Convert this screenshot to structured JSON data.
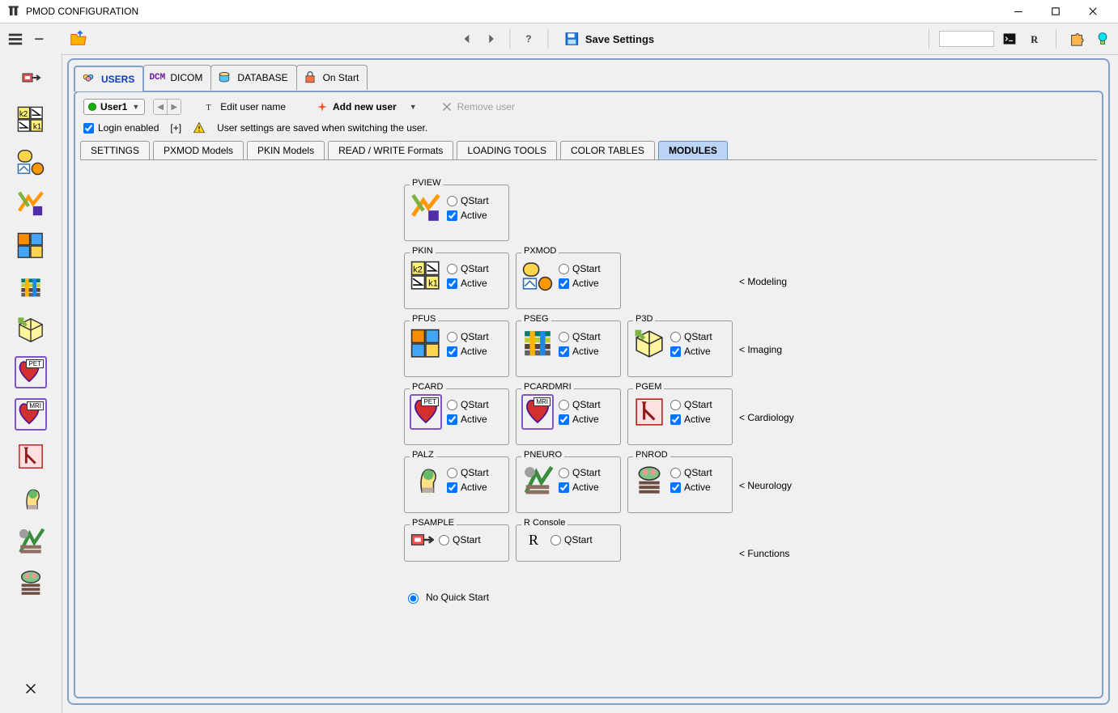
{
  "window": {
    "title": "PMOD CONFIGURATION"
  },
  "toolbar": {
    "save_label": "Save Settings",
    "help_tooltip": "?"
  },
  "primary_tabs": [
    {
      "id": "users",
      "label": "USERS",
      "active": true
    },
    {
      "id": "dicom",
      "label": "DICOM",
      "active": false
    },
    {
      "id": "database",
      "label": "DATABASE",
      "active": false
    },
    {
      "id": "onstart",
      "label": "On Start",
      "active": false
    }
  ],
  "user_bar": {
    "current_user": "User1",
    "edit_label": "Edit user name",
    "add_label": "Add new user",
    "remove_label": "Remove user"
  },
  "login_row": {
    "login_enabled_label": "Login enabled",
    "login_enabled_checked": true,
    "plus_label": "[+]",
    "info_text": "User settings are saved when switching the user."
  },
  "secondary_tabs": [
    {
      "id": "settings",
      "label": "SETTINGS",
      "active": false
    },
    {
      "id": "pxmod",
      "label": "PXMOD Models",
      "active": false
    },
    {
      "id": "pkin",
      "label": "PKIN Models",
      "active": false
    },
    {
      "id": "rw",
      "label": "READ / WRITE Formats",
      "active": false
    },
    {
      "id": "loading",
      "label": "LOADING TOOLS",
      "active": false
    },
    {
      "id": "color",
      "label": "COLOR TABLES",
      "active": false
    },
    {
      "id": "modules",
      "label": "MODULES",
      "active": true
    }
  ],
  "modules": {
    "rows": [
      {
        "label": "",
        "items": [
          {
            "code": "PVIEW",
            "icon": "pview",
            "qstart": false,
            "active": true
          }
        ]
      },
      {
        "label": "< Modeling",
        "items": [
          {
            "code": "PKIN",
            "icon": "pkin",
            "qstart": false,
            "active": true
          },
          {
            "code": "PXMOD",
            "icon": "pxmod",
            "qstart": false,
            "active": true
          }
        ]
      },
      {
        "label": "< Imaging",
        "items": [
          {
            "code": "PFUS",
            "icon": "pfus",
            "qstart": false,
            "active": true
          },
          {
            "code": "PSEG",
            "icon": "pseg",
            "qstart": false,
            "active": true
          },
          {
            "code": "P3D",
            "icon": "p3d",
            "qstart": false,
            "active": true
          }
        ]
      },
      {
        "label": "< Cardiology",
        "items": [
          {
            "code": "PCARD",
            "icon": "pcard",
            "qstart": false,
            "active": true
          },
          {
            "code": "PCARDMRI",
            "icon": "pcardmri",
            "qstart": false,
            "active": true
          },
          {
            "code": "PGEM",
            "icon": "pgem",
            "qstart": false,
            "active": true
          }
        ]
      },
      {
        "label": "< Neurology",
        "items": [
          {
            "code": "PALZ",
            "icon": "palz",
            "qstart": false,
            "active": true
          },
          {
            "code": "PNEURO",
            "icon": "pneuro",
            "qstart": false,
            "active": true
          },
          {
            "code": "PNROD",
            "icon": "pnrod",
            "qstart": false,
            "active": true
          }
        ]
      },
      {
        "label": "< Functions",
        "items": [
          {
            "code": "PSAMPLE",
            "icon": "psample",
            "qstart_only": true,
            "qstart": false
          },
          {
            "code": "R Console",
            "icon": "rconsole",
            "qstart_only": true,
            "qstart": false
          }
        ]
      }
    ],
    "qstart_label": "QStart",
    "active_label": "Active",
    "no_qstart_label": "No Quick Start",
    "no_qstart_checked": true
  },
  "colors": {
    "accent": "#85a0c7",
    "link_blue": "#0a3cc8",
    "tab_active_bg": "#bcd4f6"
  }
}
